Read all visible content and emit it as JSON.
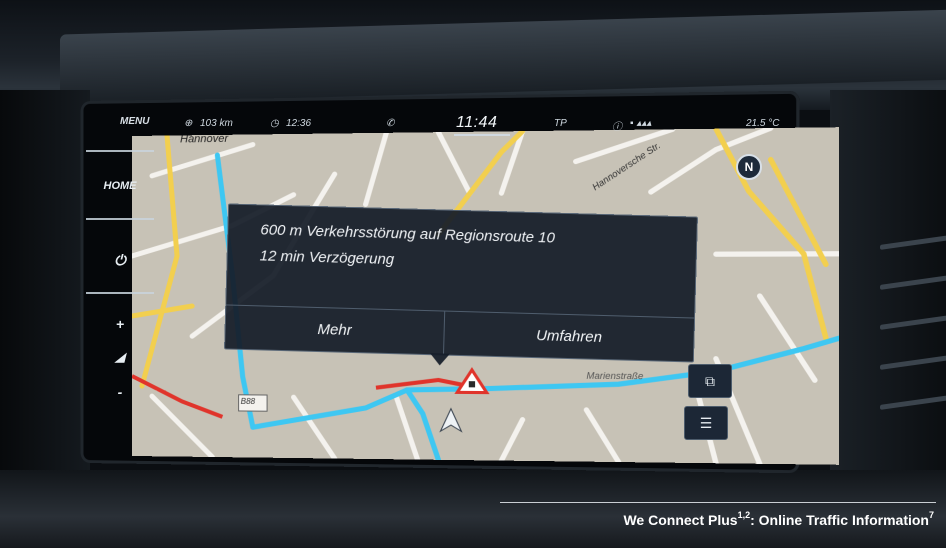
{
  "status": {
    "menu_label": "MENU",
    "range": "103 km",
    "time_remaining": "12:36",
    "clock": "11:44",
    "tp": "TP",
    "temperature": "21.5 °C"
  },
  "sidebar": {
    "home_label": "HOME",
    "power_icon": "power-icon",
    "plus_label": "+",
    "volume_icon": "volume-icon",
    "minus_label": "-"
  },
  "map": {
    "city_label": "Hannover",
    "street_upper": "Hannoversche Str.",
    "street_lower": "Marienstraße",
    "compass": "N",
    "road_number": "B88"
  },
  "popup": {
    "line1": "600 m Verkehrsstörung auf Regionsroute 10",
    "line2": "12 min Verzögerung",
    "button_more": "Mehr",
    "button_detour": "Umfahren"
  },
  "caption": {
    "prefix": "We Connect Plus",
    "superscript1": "1,2",
    "middle": ": Online Traffic Information",
    "superscript2": "7"
  },
  "colors": {
    "route_blue": "#3ec7f2",
    "traffic_red": "#e0342b",
    "popup_bg": "#141c28"
  }
}
